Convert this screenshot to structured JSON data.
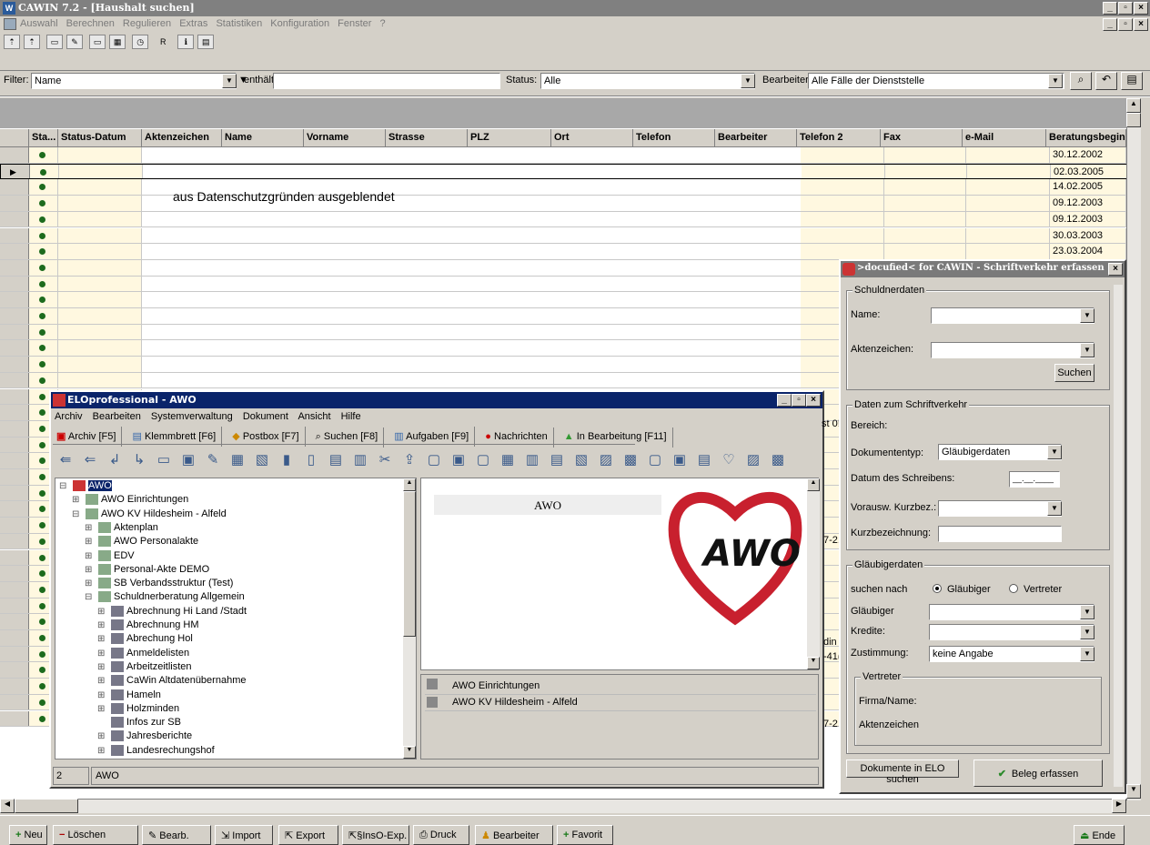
{
  "app": {
    "title": "CAWIN 7.2 - [Haushalt suchen]",
    "menu": [
      "Auswahl",
      "Berechnen",
      "Regulieren",
      "Extras",
      "Statistiken",
      "Konfiguration",
      "Fenster",
      "?"
    ],
    "toolbar_r": "R"
  },
  "filter": {
    "label": "Filter:",
    "field_value": "Name",
    "op_value": "enthält",
    "search_value": "",
    "status_label": "Status:",
    "status_value": "Alle",
    "bearbeiter_label": "Bearbeiter:",
    "bearbeiter_value": "Alle Fälle der Dienststelle"
  },
  "grid": {
    "columns": [
      "Sta...",
      "Status-Datum",
      "Aktenzeichen",
      "Name",
      "Vorname",
      "Strasse",
      "PLZ",
      "Ort",
      "Telefon",
      "Bearbeiter",
      "Telefon 2",
      "Fax",
      "e-Mail",
      "Beratungsbeginn"
    ],
    "privacy_note": "aus Datenschutzgründen ausgeblendet",
    "beratungsbeginn": [
      "30.12.2002",
      "02.03.2005",
      "14.02.2005",
      "09.12.2003",
      "09.12.2003",
      "30.03.2003",
      "23.03.2004"
    ],
    "partial_texts": [
      "st 0!",
      "7-2.",
      "din",
      "-41(",
      "7-2."
    ]
  },
  "elo": {
    "title": "ELOprofessional - AWO",
    "menu": [
      "Archiv",
      "Bearbeiten",
      "Systemverwaltung",
      "Dokument",
      "Ansicht",
      "Hilfe"
    ],
    "tabs": [
      "Archiv [F5]",
      "Klemmbrett [F6]",
      "Postbox [F7]",
      "Suchen [F8]",
      "Aufgaben [F9]",
      "Nachrichten",
      "In Bearbeitung [F11]"
    ],
    "tree": [
      {
        "label": "AWO",
        "level": 0
      },
      {
        "label": "AWO Einrichtungen",
        "level": 1
      },
      {
        "label": "AWO KV Hildesheim - Alfeld",
        "level": 1
      },
      {
        "label": "Aktenplan",
        "level": 2
      },
      {
        "label": "AWO Personalakte",
        "level": 2
      },
      {
        "label": "EDV",
        "level": 2
      },
      {
        "label": "Personal-Akte DEMO",
        "level": 2
      },
      {
        "label": "SB Verbandsstruktur (Test)",
        "level": 2
      },
      {
        "label": "Schuldnerberatung Allgemein",
        "level": 2
      },
      {
        "label": "Abrechnung Hi Land /Stadt",
        "level": 3
      },
      {
        "label": "Abrechnung HM",
        "level": 3
      },
      {
        "label": "Abrechung Hol",
        "level": 3
      },
      {
        "label": "Anmeldelisten",
        "level": 3
      },
      {
        "label": "Arbeitzeitlisten",
        "level": 3
      },
      {
        "label": "CaWin Altdatenübernahme",
        "level": 3
      },
      {
        "label": "Hameln",
        "level": 3
      },
      {
        "label": "Holzminden",
        "level": 3
      },
      {
        "label": "Infos zur SB",
        "level": 3
      },
      {
        "label": "Jahresberichte",
        "level": 3
      },
      {
        "label": "Landesrechungshof",
        "level": 3
      }
    ],
    "preview_title": "AWO",
    "logo_text": "AWO",
    "list": [
      "AWO Einrichtungen",
      "AWO KV Hildesheim - Alfeld"
    ],
    "status_count": "2",
    "status_text": "AWO"
  },
  "docufied": {
    "title": ">docufied< for CAWIN - Schriftverkehr erfassen",
    "schuldner_group": "Schuldnerdaten",
    "name_label": "Name:",
    "az_label": "Aktenzeichen:",
    "suchen": "Suchen",
    "daten_group": "Daten zum Schriftverkehr",
    "bereich_label": "Bereich:",
    "doktyp_label": "Dokumententyp:",
    "doktyp_value": "Gläubigerdaten",
    "datum_label": "Datum des Schreibens:",
    "datum_value": "__.__.____",
    "vorausw_label": "Vorausw. Kurzbez.:",
    "kurz_label": "Kurzbezeichnung:",
    "glaeub_group": "Gläubigerdaten",
    "suchen_nach": "suchen nach",
    "radio1": "Gläubiger",
    "radio2": "Vertreter",
    "glaeubiger_label": "Gläubiger",
    "kredite_label": "Kredite:",
    "zustimmung_label": "Zustimmung:",
    "zustimmung_value": "keine Angabe",
    "vertreter_group": "Vertreter",
    "firma_label": "Firma/Name:",
    "vaz_label": "Aktenzeichen",
    "elo_btn": "Dokumente in ELO suchen",
    "beleg_btn": "Beleg erfassen"
  },
  "bottom": {
    "buttons": [
      "Neu",
      "Löschen",
      "Bearb.",
      "Import",
      "Export",
      "§InsO-Exp.",
      "Druck",
      "Bearbeiter",
      "Favorit"
    ],
    "ende": "Ende"
  }
}
